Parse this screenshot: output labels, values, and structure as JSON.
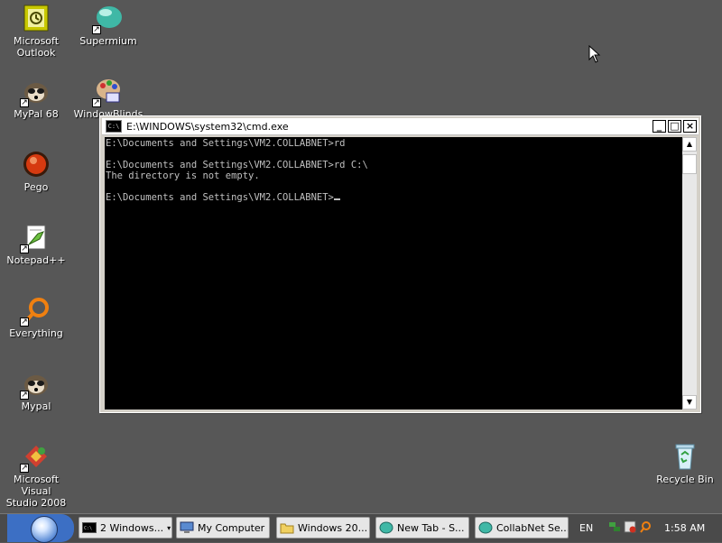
{
  "desktop": {
    "icons": [
      {
        "label": "Microsoft Outlook",
        "line1": "Microsoft",
        "line2": "Outlook"
      },
      {
        "label": "Supermium"
      },
      {
        "label": "MyPal 68"
      },
      {
        "label": "WindowBlinds"
      },
      {
        "label": "Pego"
      },
      {
        "label": "Notepad++"
      },
      {
        "label": "Everything"
      },
      {
        "label": "Mypal"
      },
      {
        "label": "Microsoft Visual Studio 2008",
        "line1": "Microsoft Visual",
        "line2": "Studio 2008"
      },
      {
        "label": "Recycle Bin"
      }
    ]
  },
  "cmd": {
    "title": "E:\\WINDOWS\\system32\\cmd.exe",
    "icon_text": "C:\\",
    "lines": [
      "E:\\Documents and Settings\\VM2.COLLABNET>rd",
      "",
      "E:\\Documents and Settings\\VM2.COLLABNET>rd C:\\",
      "The directory is not empty.",
      "",
      "E:\\Documents and Settings\\VM2.COLLABNET>"
    ],
    "minimize_label": "_",
    "maximize_label": "□",
    "close_label": "×"
  },
  "taskbar": {
    "buttons": [
      {
        "label": "2 Windows...",
        "icon": "cmd-icon"
      },
      {
        "label": "My Computer",
        "icon": "computer-icon"
      },
      {
        "label": "Windows 20...",
        "icon": "folder-icon"
      },
      {
        "label": "New Tab - S...",
        "icon": "supermium-icon"
      },
      {
        "label": "CollabNet Se...",
        "icon": "supermium-icon"
      }
    ],
    "language": "EN",
    "clock": "1:58 AM"
  }
}
